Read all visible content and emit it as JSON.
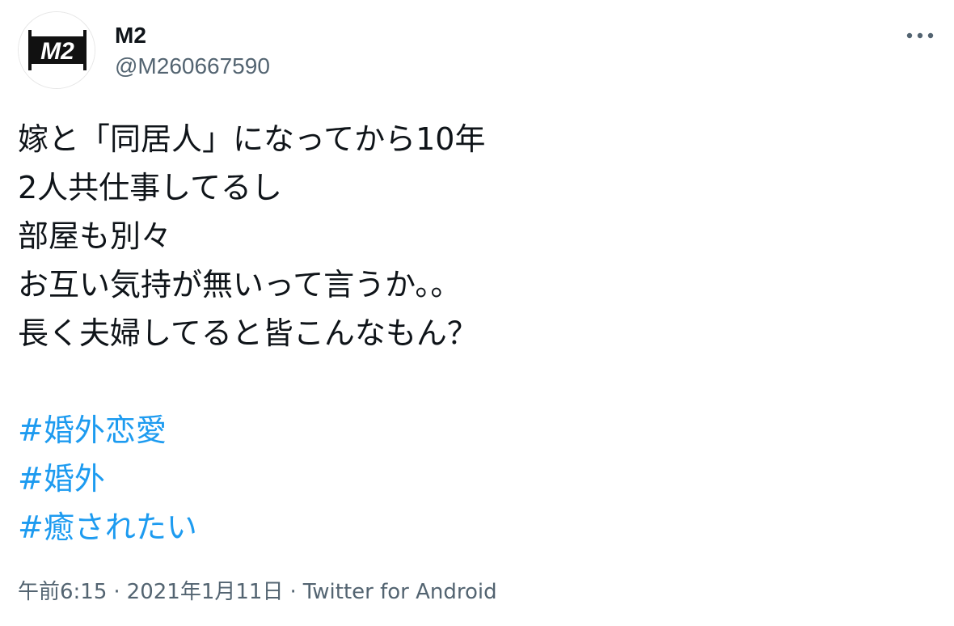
{
  "author": {
    "display_name": "M2",
    "handle": "@M260667590",
    "avatar_icon": "m2-logo-icon",
    "avatar_logo_text": "M2"
  },
  "more_icon": "more-horizontal-icon",
  "tweet": {
    "lines": [
      "嫁と「同居人」になってから10年",
      "2人共仕事してるし",
      "部屋も別々",
      "お互い気持が無いって言うか。。",
      "長く夫婦してると皆こんなもん？"
    ],
    "hashtags": [
      "#婚外恋愛",
      "#婚外",
      "#癒されたい"
    ]
  },
  "meta": {
    "time": "午前6:15",
    "date": "2021年1月11日",
    "separator": "·",
    "source": "Twitter for Android"
  },
  "colors": {
    "link": "#1d9bf0",
    "secondary_text": "#536471",
    "primary_text": "#0f1419"
  }
}
